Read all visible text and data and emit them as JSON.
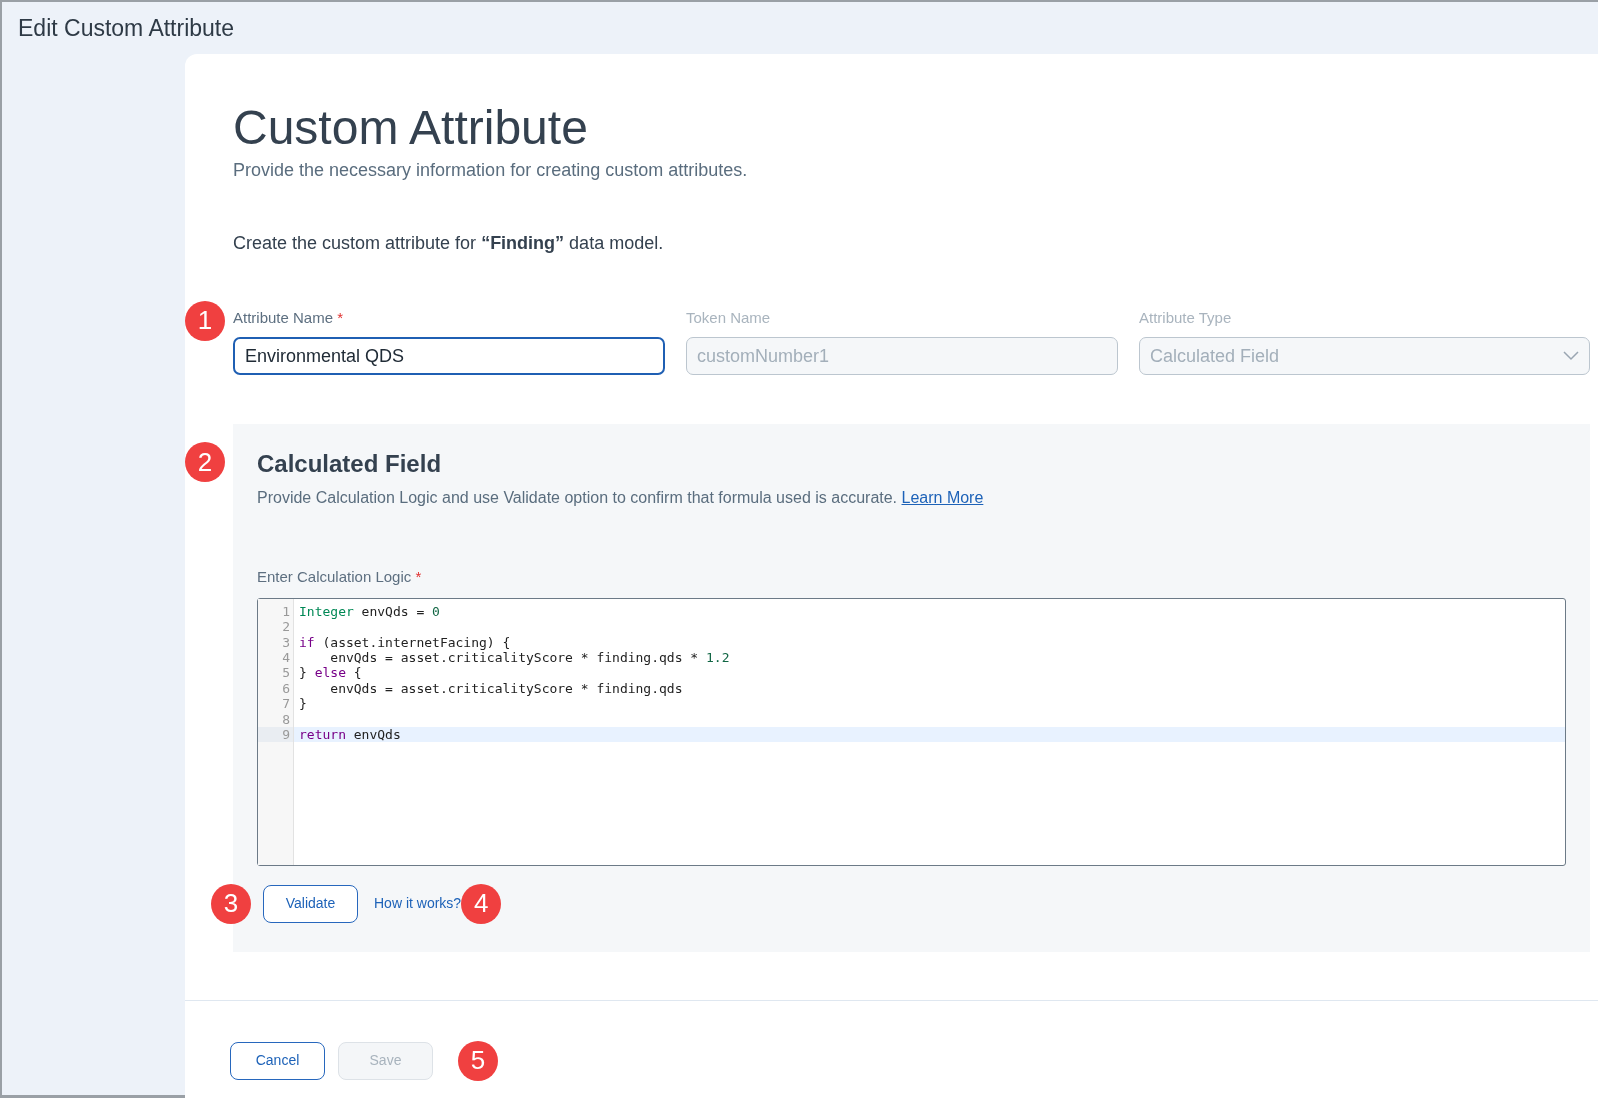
{
  "window": {
    "title": "Edit Custom Attribute"
  },
  "header": {
    "title": "Custom Attribute",
    "subtitle": "Provide the necessary information for creating custom attributes.",
    "intro": "Create the custom attribute for **“Finding”** data model."
  },
  "fields": [
    {
      "kind": "text",
      "label": "Attribute Name",
      "required_mark": "*",
      "value": "Environmental QDS",
      "disabled": false,
      "focused": true
    },
    {
      "kind": "text",
      "label": "Token Name",
      "value": "customNumber1",
      "disabled": true,
      "focused": false
    },
    {
      "kind": "select",
      "label": "Attribute Type",
      "value": "Calculated Field",
      "disabled": true,
      "focused": false
    }
  ],
  "calculated": {
    "title": "Calculated Field",
    "description": "Provide Calculation Logic and use Validate option to confirm that formula used is accurate.",
    "link": "Learn More",
    "editor_label": "Enter Calculation Logic",
    "required_mark": "*",
    "lines": [
      {
        "number": "1",
        "current": false,
        "tokens": [
          {
            "kind": "type",
            "text": "Integer"
          },
          {
            "kind": "plain",
            "text": " envQds = "
          },
          {
            "kind": "number",
            "text": "0"
          }
        ]
      },
      {
        "number": "2",
        "current": false
      },
      {
        "number": "3",
        "current": false,
        "tokens": [
          {
            "kind": "keyword",
            "text": "if"
          },
          {
            "kind": "plain",
            "text": " (asset.internetFacing) {"
          }
        ]
      },
      {
        "number": "4",
        "current": false,
        "tokens": [
          {
            "kind": "plain",
            "text": "    envQds = asset.criticalityScore * finding.qds * "
          },
          {
            "kind": "number",
            "text": "1.2"
          }
        ]
      },
      {
        "number": "5",
        "current": false,
        "tokens": [
          {
            "kind": "plain",
            "text": "} "
          },
          {
            "kind": "keyword",
            "text": "else"
          },
          {
            "kind": "plain",
            "text": " {"
          }
        ]
      },
      {
        "number": "6",
        "current": false,
        "tokens": [
          {
            "kind": "plain",
            "text": "    envQds = asset.criticalityScore * finding.qds"
          }
        ]
      },
      {
        "number": "7",
        "current": false,
        "tokens": [
          {
            "kind": "plain",
            "text": "}"
          }
        ]
      },
      {
        "number": "8",
        "current": false
      },
      {
        "number": "9",
        "current": true,
        "tokens": [
          {
            "kind": "keyword",
            "text": "return"
          },
          {
            "kind": "plain",
            "text": " envQds"
          }
        ]
      }
    ],
    "validate_button": "Validate",
    "help_link": "How it works?"
  },
  "footer": {
    "buttons": [
      {
        "label": "Cancel",
        "disabled": false
      },
      {
        "label": "Save",
        "disabled": true
      }
    ]
  },
  "callouts": [
    "1",
    "2",
    "3",
    "4",
    "5"
  ]
}
